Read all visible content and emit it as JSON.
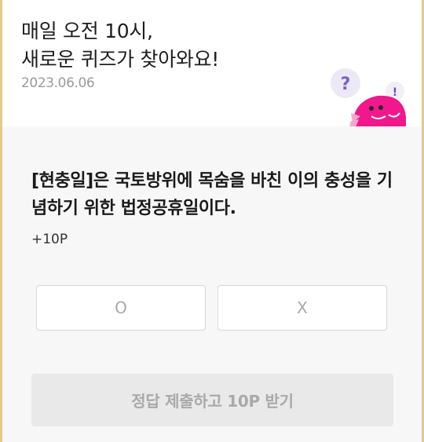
{
  "header": {
    "headline_line1": "매일 오전 10시,",
    "headline_line2": "새로운 퀴즈가 찾아와요!",
    "date": "2023.06.06"
  },
  "mascot": {
    "question_mark": "?",
    "exclaim_mark": "!",
    "body_color": "#f0188c"
  },
  "quiz": {
    "question": "[현충일]은 국토방위에 목숨을 바친 이의 충성을 기념하기 위한 법정공휴일이다.",
    "points": "+10P",
    "option_o": "O",
    "option_x": "X",
    "submit_label": "정답 제출하고 10P 받기"
  },
  "colors": {
    "frame_accent": "#e3c98a",
    "panel_bg": "#f7f7f7",
    "button_disabled_bg": "#e9e9e9"
  }
}
